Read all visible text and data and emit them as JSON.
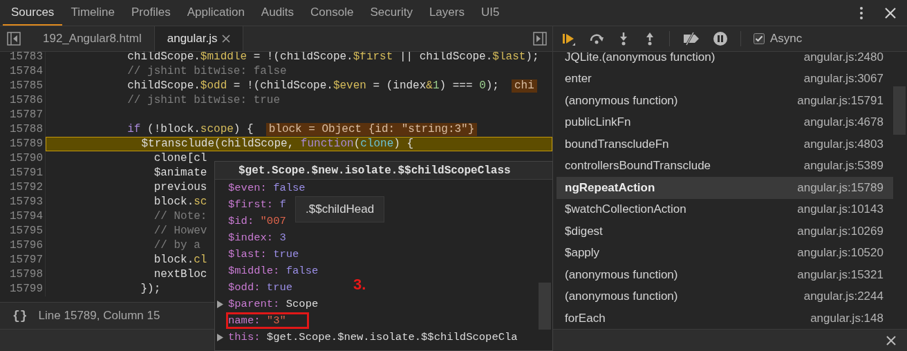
{
  "tabs": [
    {
      "label": "Sources",
      "selected": true
    },
    {
      "label": "Timeline",
      "selected": false
    },
    {
      "label": "Profiles",
      "selected": false
    },
    {
      "label": "Application",
      "selected": false
    },
    {
      "label": "Audits",
      "selected": false
    },
    {
      "label": "Console",
      "selected": false
    },
    {
      "label": "Security",
      "selected": false
    },
    {
      "label": "Layers",
      "selected": false
    },
    {
      "label": "UI5",
      "selected": false
    }
  ],
  "file_tabs": [
    {
      "label": "192_Angular8.html",
      "selected": false,
      "closable": false
    },
    {
      "label": "angular.js",
      "selected": true,
      "closable": true
    }
  ],
  "code": {
    "lines": [
      {
        "number": "15783",
        "current": false,
        "tokens": [
          {
            "text": "            childScope.",
            "kind": "plain"
          },
          {
            "text": "$middle",
            "kind": "property"
          },
          {
            "text": " = !(childScope.",
            "kind": "plain"
          },
          {
            "text": "$first",
            "kind": "property"
          },
          {
            "text": " || childScope.",
            "kind": "plain"
          },
          {
            "text": "$last",
            "kind": "property"
          },
          {
            "text": ");",
            "kind": "plain"
          }
        ]
      },
      {
        "number": "15784",
        "current": false,
        "tokens": [
          {
            "text": "            // jshint bitwise: false",
            "kind": "comment"
          }
        ]
      },
      {
        "number": "15785",
        "current": false,
        "tokens": [
          {
            "text": "            childScope.",
            "kind": "plain"
          },
          {
            "text": "$odd",
            "kind": "property"
          },
          {
            "text": " = !(childScope.",
            "kind": "plain"
          },
          {
            "text": "$even",
            "kind": "property"
          },
          {
            "text": " = (index",
            "kind": "plain"
          },
          {
            "text": "&",
            "kind": "property"
          },
          {
            "text": "1",
            "kind": "number"
          },
          {
            "text": ") === ",
            "kind": "plain"
          },
          {
            "text": "0",
            "kind": "number"
          },
          {
            "text": ");",
            "kind": "plain"
          }
        ],
        "inline_value": "chi"
      },
      {
        "number": "15786",
        "current": false,
        "tokens": [
          {
            "text": "            // jshint bitwise: true",
            "kind": "comment"
          }
        ]
      },
      {
        "number": "15787",
        "current": false
      },
      {
        "number": "15788",
        "current": false,
        "tokens": [
          {
            "text": "            if",
            "kind": "keyword"
          },
          {
            "text": " (!block.",
            "kind": "plain"
          },
          {
            "text": "scope",
            "kind": "property"
          },
          {
            "text": ") {",
            "kind": "plain"
          }
        ],
        "inline_value": "block = Object {id: \"string:3\"}"
      },
      {
        "number": "15789",
        "current": true,
        "tokens": [
          {
            "text": "              $transclude(childScope, ",
            "kind": "plain"
          },
          {
            "text": "function",
            "kind": "keyword"
          },
          {
            "text": "(",
            "kind": "plain"
          },
          {
            "text": "clone",
            "kind": "parameter"
          },
          {
            "text": ") {",
            "kind": "plain"
          }
        ]
      },
      {
        "number": "15790",
        "current": false,
        "tokens": [
          {
            "text": "                clone[cl",
            "kind": "plain"
          }
        ]
      },
      {
        "number": "15791",
        "current": false,
        "tokens": [
          {
            "text": "                $animate",
            "kind": "plain"
          }
        ]
      },
      {
        "number": "15792",
        "current": false,
        "tokens": [
          {
            "text": "                previous",
            "kind": "plain"
          }
        ]
      },
      {
        "number": "15793",
        "current": false,
        "tokens": [
          {
            "text": "                block.",
            "kind": "plain"
          },
          {
            "text": "sc",
            "kind": "property"
          }
        ]
      },
      {
        "number": "15794",
        "current": false,
        "tokens": [
          {
            "text": "                // Note:",
            "kind": "comment"
          }
        ]
      },
      {
        "number": "15795",
        "current": false,
        "tokens": [
          {
            "text": "                // Howev",
            "kind": "comment"
          }
        ]
      },
      {
        "number": "15796",
        "current": false,
        "tokens": [
          {
            "text": "                // by a",
            "kind": "comment"
          }
        ]
      },
      {
        "number": "15797",
        "current": false,
        "tokens": [
          {
            "text": "                block.",
            "kind": "plain"
          },
          {
            "text": "cl",
            "kind": "property"
          }
        ]
      },
      {
        "number": "15798",
        "current": false,
        "tokens": [
          {
            "text": "                nextBloc",
            "kind": "plain"
          }
        ]
      },
      {
        "number": "15799",
        "current": false,
        "tokens": [
          {
            "text": "              });",
            "kind": "plain"
          }
        ]
      }
    ]
  },
  "format_button": "{}",
  "status": "Line 15789, Column 15",
  "popup": {
    "title": "$get.Scope.$new.isolate.$$childScopeClass",
    "properties": [
      {
        "key": "$even:",
        "value": "false",
        "kind": "literal",
        "expandable": false,
        "outlined": false
      },
      {
        "key": "$first:",
        "value": "f",
        "kind": "literal",
        "expandable": false,
        "outlined": false
      },
      {
        "key": "$id:",
        "value": "\"007",
        "kind": "string",
        "expandable": false,
        "outlined": false
      },
      {
        "key": "$index:",
        "value": "3",
        "kind": "literal",
        "expandable": false,
        "outlined": false
      },
      {
        "key": "$last:",
        "value": "true",
        "kind": "literal",
        "expandable": false,
        "outlined": false
      },
      {
        "key": "$middle:",
        "value": "false",
        "kind": "literal",
        "expandable": false,
        "outlined": false
      },
      {
        "key": "$odd:",
        "value": "true",
        "kind": "literal",
        "expandable": false,
        "outlined": false
      },
      {
        "key": "$parent:",
        "value": "Scope",
        "kind": "object",
        "expandable": true,
        "outlined": false
      },
      {
        "key": "name:",
        "value": "\"3\"",
        "kind": "string",
        "expandable": false,
        "outlined": true
      },
      {
        "key": "this:",
        "value": "$get.Scope.$new.isolate.$$childScopeCla",
        "kind": "object",
        "expandable": true,
        "outlined": false
      }
    ],
    "tooltip": ".$$childHead",
    "annotation": "3."
  },
  "async": {
    "label": "Async",
    "checked": true
  },
  "call_stack": [
    {
      "function": "JQLite.(anonymous function)",
      "location": "angular.js:2480",
      "selected": false
    },
    {
      "function": "enter",
      "location": "angular.js:3067",
      "selected": false
    },
    {
      "function": "(anonymous function)",
      "location": "angular.js:15791",
      "selected": false
    },
    {
      "function": "publicLinkFn",
      "location": "angular.js:4678",
      "selected": false
    },
    {
      "function": "boundTranscludeFn",
      "location": "angular.js:4803",
      "selected": false
    },
    {
      "function": "controllersBoundTransclude",
      "location": "angular.js:5389",
      "selected": false
    },
    {
      "function": "ngRepeatAction",
      "location": "angular.js:15789",
      "selected": true
    },
    {
      "function": "$watchCollectionAction",
      "location": "angular.js:10143",
      "selected": false
    },
    {
      "function": "$digest",
      "location": "angular.js:10269",
      "selected": false
    },
    {
      "function": "$apply",
      "location": "angular.js:10520",
      "selected": false
    },
    {
      "function": "(anonymous function)",
      "location": "angular.js:15321",
      "selected": false
    },
    {
      "function": "(anonymous function)",
      "location": "angular.js:2244",
      "selected": false
    },
    {
      "function": "forEach",
      "location": "angular.js:148",
      "selected": false
    }
  ]
}
